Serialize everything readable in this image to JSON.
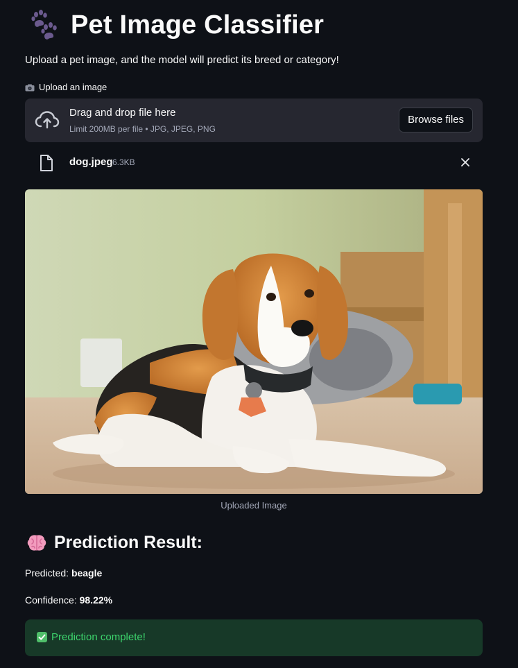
{
  "header": {
    "title": "Pet Image Classifier",
    "title_icon": "paw-prints-icon",
    "subtitle": "Upload a pet image, and the model will predict its breed or category!"
  },
  "uploader": {
    "label": "Upload an image",
    "label_icon": "camera-icon",
    "drop_title": "Drag and drop file here",
    "drop_limit": "Limit 200MB per file • JPG, JPEG, PNG",
    "browse_label": "Browse files",
    "upload_icon": "cloud-upload-icon"
  },
  "uploaded_file": {
    "name": "dog.jpeg",
    "size": "6.3KB",
    "icon": "file-icon",
    "remove_icon": "close-icon"
  },
  "image": {
    "caption": "Uploaded Image",
    "subject": "beagle-photo"
  },
  "result": {
    "heading": "Prediction Result:",
    "heading_icon": "brain-icon",
    "predicted_label": "Predicted:",
    "predicted_value": "beagle",
    "confidence_label": "Confidence:",
    "confidence_value": "98.22%",
    "status": "Prediction complete!",
    "status_icon": "check-mark-icon"
  },
  "colors": {
    "background": "#0e1117",
    "panel": "#262730",
    "text": "#fafafa",
    "muted": "#a3a8b8",
    "success_bg": "#173928",
    "success_text": "#3dd56d"
  }
}
